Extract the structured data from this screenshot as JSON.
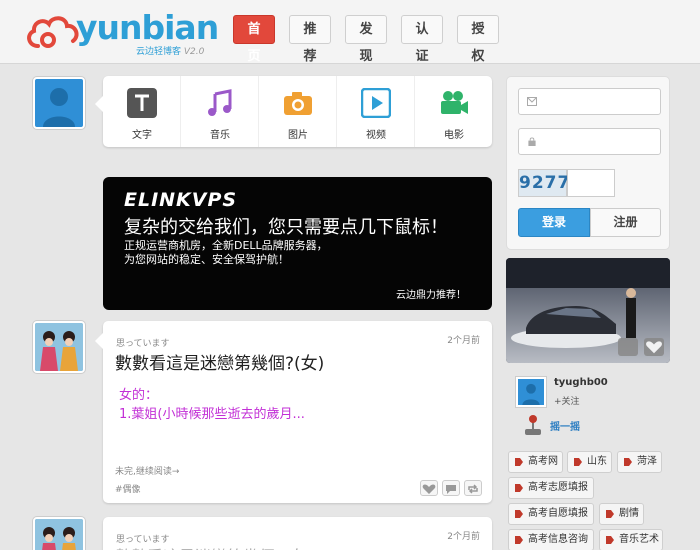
{
  "header": {
    "logo_text": "yunbian",
    "logo_sub": "云边轻博客",
    "logo_version": "V2.0",
    "nav": [
      "首页",
      "推荐",
      "发现",
      "认证",
      "授权"
    ]
  },
  "post_types": [
    "文字",
    "音乐",
    "图片",
    "视频",
    "电影"
  ],
  "ad": {
    "brand": "ELINKVPS",
    "line1": "复杂的交给我们，您只需要点几下鼠标！",
    "line2": "正规运营商机房，全新DELL品牌服务器，",
    "line3": "为您网站的稳定、安全保驾护航！",
    "recommend": "云边鼎力推荐！"
  },
  "post": {
    "meta": "思っています",
    "time": "2个月前",
    "title": "數數看這是迷戀第幾個?(女)",
    "quote1": "女的：",
    "quote2": "1.葉姐(小時候那些逝去的歲月...",
    "readmore": "未完,继续阅读→",
    "tag": "#偶像"
  },
  "post2": {
    "meta": "思っています",
    "time": "2个月前"
  },
  "login": {
    "captcha": "9277",
    "login_label": "登录",
    "register_label": "注册"
  },
  "user": {
    "name": "tyughb00",
    "follow": "+关注",
    "shake": "摇一摇"
  },
  "tags": [
    "高考网",
    "山东",
    "菏泽",
    "高考志愿填报",
    "高考自愿填报",
    "剧情",
    "高考信息咨询",
    "音乐艺术"
  ],
  "colors": {
    "accent_blue": "#2e9fd6",
    "nav_active": "#e2483b",
    "quote_purple": "#c22fd6"
  }
}
